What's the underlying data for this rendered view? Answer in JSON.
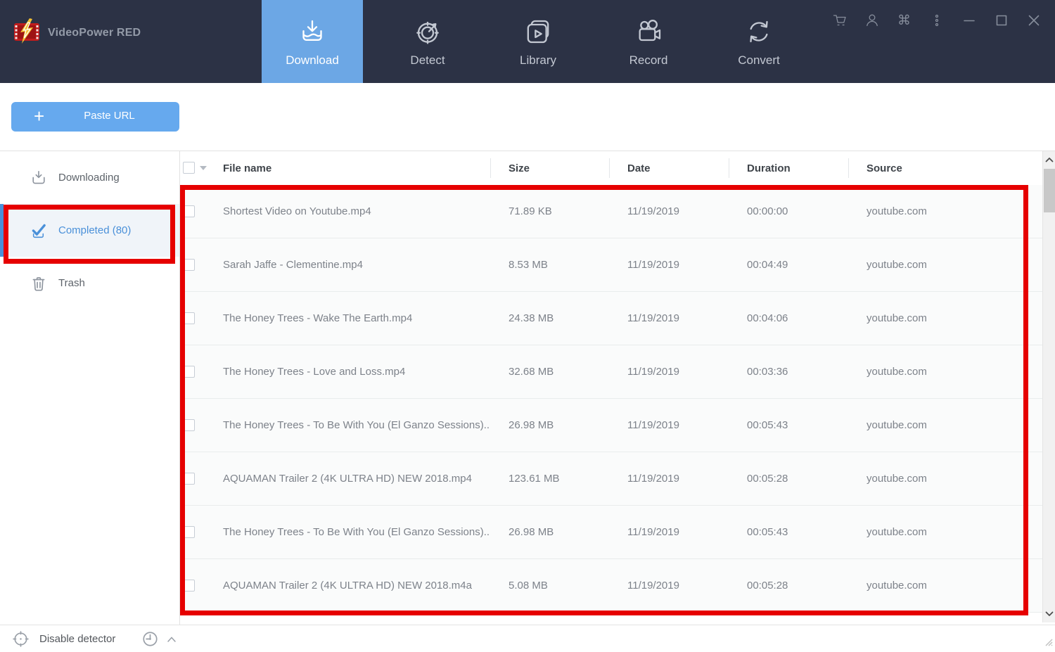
{
  "app": {
    "title": "VideoPower RED"
  },
  "nav": {
    "tabs": [
      {
        "label": "Download",
        "active": true
      },
      {
        "label": "Detect",
        "active": false
      },
      {
        "label": "Library",
        "active": false
      },
      {
        "label": "Record",
        "active": false
      },
      {
        "label": "Convert",
        "active": false
      }
    ],
    "window_icons": [
      "cart-icon",
      "user-icon",
      "commands-icon",
      "kebab-menu-icon",
      "minimize-icon",
      "maximize-icon",
      "close-icon"
    ]
  },
  "toolbar": {
    "plus_sign": "+",
    "paste_url_label": "Paste URL",
    "icons": [
      "batch-download-icon",
      "sound-icon",
      "dropdown-caret-icon",
      "download-arrow-icon",
      "pause-icon",
      "delete-icon",
      "open-folder-icon"
    ]
  },
  "sidebar": {
    "items": [
      {
        "label": "Downloading",
        "selected": false
      },
      {
        "label": "Completed (80)",
        "selected": true
      },
      {
        "label": "Trash",
        "selected": false
      }
    ]
  },
  "table": {
    "columns": [
      "File name",
      "Size",
      "Date",
      "Duration",
      "Source"
    ],
    "rows": [
      {
        "name": "Shortest Video on Youtube.mp4",
        "size": "71.89 KB",
        "date": "11/19/2019",
        "duration": "00:00:00",
        "source": "youtube.com"
      },
      {
        "name": "Sarah Jaffe - Clementine.mp4",
        "size": "8.53 MB",
        "date": "11/19/2019",
        "duration": "00:04:49",
        "source": "youtube.com"
      },
      {
        "name": "The Honey Trees - Wake The Earth.mp4",
        "size": "24.38 MB",
        "date": "11/19/2019",
        "duration": "00:04:06",
        "source": "youtube.com"
      },
      {
        "name": "The Honey Trees - Love and Loss.mp4",
        "size": "32.68 MB",
        "date": "11/19/2019",
        "duration": "00:03:36",
        "source": "youtube.com"
      },
      {
        "name": "The Honey Trees - To Be With You (El Ganzo Sessions)...",
        "size": "26.98 MB",
        "date": "11/19/2019",
        "duration": "00:05:43",
        "source": "youtube.com"
      },
      {
        "name": "AQUAMAN Trailer 2 (4K ULTRA HD) NEW 2018.mp4",
        "size": "123.61 MB",
        "date": "11/19/2019",
        "duration": "00:05:28",
        "source": "youtube.com"
      },
      {
        "name": "The Honey Trees - To Be With You (El Ganzo Sessions)...",
        "size": "26.98 MB",
        "date": "11/19/2019",
        "duration": "00:05:43",
        "source": "youtube.com"
      },
      {
        "name": "AQUAMAN Trailer 2 (4K ULTRA HD) NEW 2018.m4a",
        "size": "5.08 MB",
        "date": "11/19/2019",
        "duration": "00:05:28",
        "source": "youtube.com"
      }
    ]
  },
  "statusbar": {
    "disable_detector_label": "Disable detector"
  },
  "colors": {
    "topbar": "#2c3245",
    "active_tab": "#6ca7e5",
    "paste_button": "#66a9ee",
    "selected_blue": "#4a90d9",
    "annotation_red": "#e60000"
  }
}
